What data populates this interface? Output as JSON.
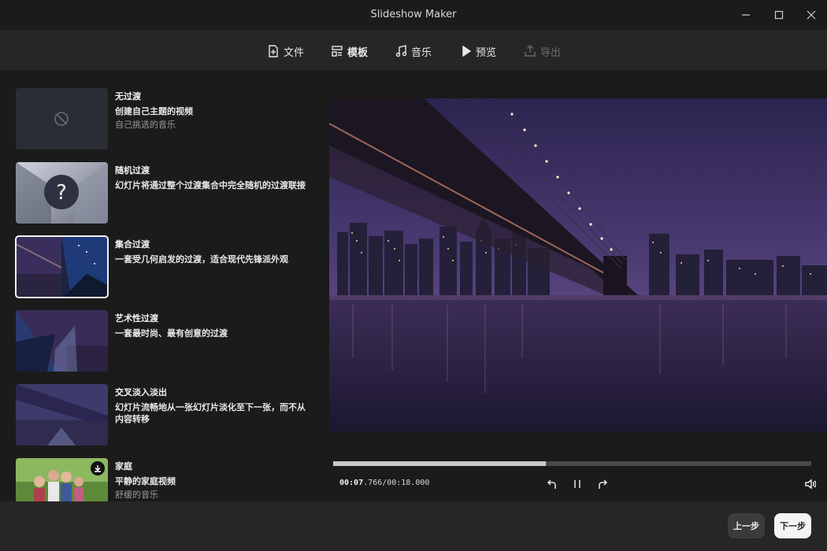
{
  "window": {
    "title": "Slideshow Maker"
  },
  "toolbar": {
    "tabs": [
      {
        "label": "文件",
        "icon": "file-add-icon",
        "state": "normal"
      },
      {
        "label": "模板",
        "icon": "template-icon",
        "state": "active"
      },
      {
        "label": "音乐",
        "icon": "music-note-icon",
        "state": "normal"
      },
      {
        "label": "预览",
        "icon": "play-icon",
        "state": "normal"
      },
      {
        "label": "导出",
        "icon": "export-icon",
        "state": "disabled"
      }
    ]
  },
  "templates": [
    {
      "name": "无过渡",
      "desc": "创建自己主题的视频",
      "sub": "自己挑选的音乐",
      "thumb": "none"
    },
    {
      "name": "随机过渡",
      "desc": "幻灯片将通过整个过渡集合中完全随机的过渡联接",
      "sub": "",
      "thumb": "random"
    },
    {
      "name": "集合过渡",
      "desc": "一套受几何启发的过渡，适合现代先锋派外观",
      "sub": "",
      "thumb": "geometric",
      "selected": true
    },
    {
      "name": "艺术性过渡",
      "desc": "一套最时尚、最有创意的过渡",
      "sub": "",
      "thumb": "artistic"
    },
    {
      "name": "交叉淡入淡出",
      "desc": "幻灯片流畅地从一张幻灯片淡化至下一张，而不从内容转移",
      "sub": "",
      "thumb": "crossfade"
    },
    {
      "name": "家庭",
      "desc": "平静的家庭视频",
      "sub": "舒缓的音乐",
      "thumb": "family",
      "downloadable": true
    }
  ],
  "player": {
    "current": "00:07",
    "current_ms": ".766",
    "total": "/00:18.000",
    "progress": 0.445
  },
  "footer": {
    "prev_label": "上一步",
    "next_label": "下一步"
  },
  "colors": {
    "background": "#1b1b1b",
    "toolbar": "#262626",
    "accent": "#f4f4f4",
    "night_sky": "#4a3a72"
  }
}
